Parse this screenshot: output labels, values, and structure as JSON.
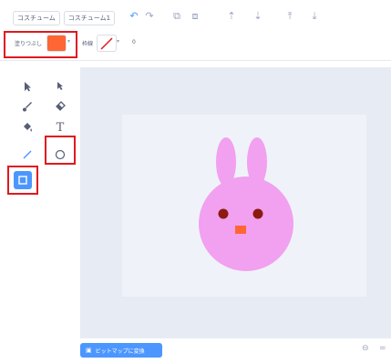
{
  "toolbar": {
    "costume_name": "コスチューム",
    "costume_name2": "コスチューム1"
  },
  "properties": {
    "fill_label": "塗りつぶし",
    "fill_color": "#ff6633",
    "outline_label": "枠線",
    "outline_width": "0"
  },
  "tools": [
    {
      "name": "select-tool",
      "icon": "arrow-icon"
    },
    {
      "name": "reshape-tool",
      "icon": "reshape-icon"
    },
    {
      "name": "brush-tool",
      "icon": "brush-icon"
    },
    {
      "name": "eraser-tool",
      "icon": "eraser-icon"
    },
    {
      "name": "fill-tool",
      "icon": "bucket-icon"
    },
    {
      "name": "text-tool",
      "icon": "text-icon",
      "glyph": "T"
    },
    {
      "name": "line-tool",
      "icon": "line-icon"
    },
    {
      "name": "circle-tool",
      "icon": "circle-icon"
    },
    {
      "name": "rectangle-tool",
      "icon": "rectangle-icon"
    }
  ],
  "bottom": {
    "convert_label": "ビットマップに変換"
  },
  "colors": {
    "accent": "#4c97ff",
    "highlight": "#e0181f",
    "bunny": "#f2a0f0",
    "eyes": "#8b1a10",
    "nose": "#ff6633"
  }
}
